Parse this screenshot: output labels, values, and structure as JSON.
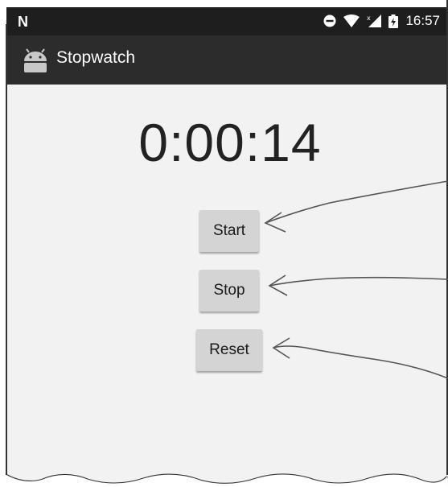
{
  "status_bar": {
    "left_icon": "N",
    "icons": [
      "do-not-disturb-icon",
      "wifi-icon",
      "cell-signal-icon",
      "battery-charging-icon"
    ],
    "time": "16:57"
  },
  "action_bar": {
    "app_icon": "android-icon",
    "title": "Stopwatch"
  },
  "stopwatch": {
    "time_display": "0:00:14",
    "buttons": {
      "start": "Start",
      "stop": "Stop",
      "reset": "Reset"
    }
  },
  "colors": {
    "status_bar": "#1e1e1e",
    "action_bar": "#2c2c2c",
    "background": "#f2f2f2",
    "button": "#d4d4d4"
  }
}
